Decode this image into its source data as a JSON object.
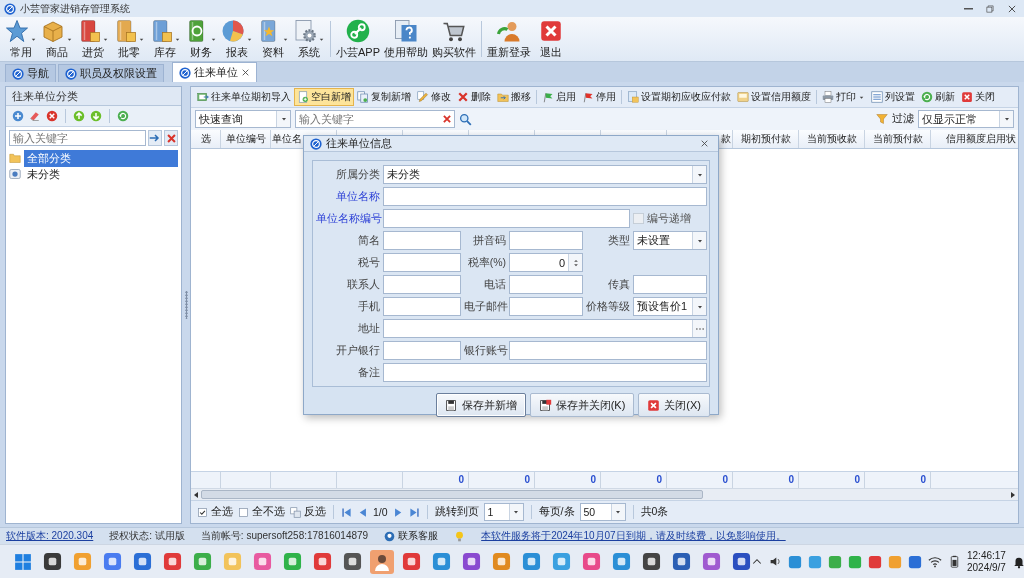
{
  "window": {
    "title": "小芸管家进销存管理系统"
  },
  "ribbon": {
    "groups": [
      [
        {
          "label": "常用",
          "dropdown": true
        },
        {
          "label": "商品",
          "dropdown": true
        },
        {
          "label": "进货",
          "dropdown": true
        },
        {
          "label": "批零",
          "dropdown": true
        },
        {
          "label": "库存",
          "dropdown": true
        },
        {
          "label": "财务",
          "dropdown": true
        },
        {
          "label": "报表",
          "dropdown": true
        },
        {
          "label": "资料",
          "dropdown": true
        },
        {
          "label": "系统",
          "dropdown": true
        }
      ],
      [
        {
          "label": "小芸APP",
          "dropdown": false
        },
        {
          "label": "使用帮助",
          "dropdown": false
        },
        {
          "label": "购买软件",
          "dropdown": false
        }
      ],
      [
        {
          "label": "重新登录",
          "dropdown": false
        },
        {
          "label": "退出",
          "dropdown": false
        }
      ]
    ]
  },
  "tabs": [
    {
      "label": "导航",
      "selected": false,
      "closable": false
    },
    {
      "label": "职员及权限设置",
      "selected": false,
      "closable": false
    },
    {
      "label": "往来单位",
      "selected": true,
      "closable": true
    }
  ],
  "category_panel": {
    "title": "往来单位分类",
    "search": {
      "placeholder": "输入关键字"
    },
    "tree": [
      {
        "label": "全部分类",
        "selected": true
      },
      {
        "label": "未分类",
        "selected": false
      }
    ]
  },
  "toolbar": {
    "groups": [
      [
        {
          "label": "往来单位期初导入",
          "selected": false,
          "dropdown": false
        },
        {
          "label": "空白新增",
          "selected": true,
          "dropdown": false
        },
        {
          "label": "复制新增",
          "selected": false,
          "dropdown": false
        },
        {
          "label": "修改",
          "selected": false,
          "dropdown": false
        },
        {
          "label": "删除",
          "selected": false,
          "dropdown": false
        },
        {
          "label": "搬移",
          "selected": false,
          "dropdown": false
        }
      ],
      [
        {
          "label": "启用",
          "selected": false,
          "dropdown": false
        },
        {
          "label": "停用",
          "selected": false,
          "dropdown": false
        }
      ],
      [
        {
          "label": "设置期初应收应付款",
          "selected": false,
          "dropdown": false
        },
        {
          "label": "设置信用额度",
          "selected": false,
          "dropdown": false
        }
      ],
      [
        {
          "label": "打印",
          "selected": false,
          "dropdown": true
        },
        {
          "label": "列设置",
          "selected": false,
          "dropdown": false
        },
        {
          "label": "刷新",
          "selected": false,
          "dropdown": false
        },
        {
          "label": "关闭",
          "selected": false,
          "dropdown": false
        }
      ]
    ]
  },
  "query": {
    "mode": "快速查询",
    "search": {
      "placeholder": "输入关键字"
    },
    "filter_label": "过滤",
    "filter": "仅显示正常"
  },
  "table": {
    "columns": [
      "选",
      "单位编号",
      "单位名",
      "款",
      "期初预付款",
      "当前预收款",
      "当前预付款",
      "信用额度启用状"
    ],
    "totals": [
      "0",
      "0",
      "0",
      "0",
      "0",
      "0",
      "0",
      "0"
    ]
  },
  "pager": {
    "select_all": "全选",
    "select_none": "全不选",
    "invert": "反选",
    "page": "1/0",
    "goto_label": "跳转到页",
    "goto": "1",
    "per_page_label": "每页/条",
    "per_page": "50",
    "total": "共0条"
  },
  "dialog": {
    "title": "往来单位信息",
    "rows": [
      [
        {
          "kind": "select",
          "label": "所属分类",
          "value": "未分类",
          "required": false
        }
      ],
      [
        {
          "kind": "text",
          "label": "单位名称",
          "required": true
        }
      ],
      [
        {
          "kind": "text",
          "label": "单位名称编号",
          "required": true
        },
        "",
        {
          "kind": "checkbox",
          "label": "编号递增",
          "checked": false,
          "disabled": true
        }
      ],
      [
        {
          "kind": "text",
          "label": "简名",
          "required": false
        },
        {
          "kind": "text",
          "label": "拼音码",
          "required": false
        },
        {
          "kind": "select",
          "label": "类型",
          "value": "未设置",
          "required": false
        }
      ],
      [
        {
          "kind": "text",
          "label": "税号",
          "required": false
        },
        {
          "kind": "spin",
          "label": "税率(%)",
          "value": "0",
          "required": false
        }
      ],
      [
        {
          "kind": "text",
          "label": "联系人",
          "required": false
        },
        {
          "kind": "text",
          "label": "电话",
          "required": false
        },
        {
          "kind": "text",
          "label": "传真",
          "required": false
        }
      ],
      [
        {
          "kind": "text",
          "label": "手机",
          "required": false
        },
        {
          "kind": "text",
          "label": "电子邮件",
          "required": false
        },
        {
          "kind": "select",
          "label": "价格等级",
          "value": "预设售价1",
          "required": false
        }
      ],
      [
        {
          "kind": "browse",
          "label": "地址",
          "required": false
        }
      ],
      [
        {
          "kind": "text",
          "label": "开户银行",
          "required": false
        },
        {
          "kind": "text",
          "label": "银行账号",
          "required": false
        }
      ],
      [
        {
          "kind": "text",
          "label": "备注",
          "required": false
        }
      ]
    ],
    "buttons": [
      {
        "label": "保存并新增",
        "focused": true
      },
      {
        "label": "保存并关闭(K)",
        "focused": false
      },
      {
        "label": "关闭(X)",
        "focused": false
      }
    ]
  },
  "status_bar": {
    "version": "软件版本: 2020.304",
    "license": "授权状态: 试用版",
    "account": "当前帐号: supersoft258:17816014879",
    "support": "联系客服",
    "notice": "本软件服务将于2024年10月07日到期，请及时续费，以免影响使用。"
  },
  "taskbar": {
    "time": "12:46:17",
    "date": "2024/9/7"
  }
}
